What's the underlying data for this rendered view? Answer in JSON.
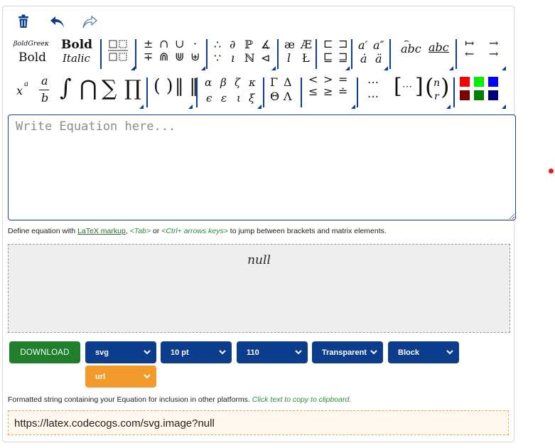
{
  "editor": {
    "placeholder": "Write Equation here...",
    "value": ""
  },
  "toolbar": {
    "icons": [
      "trash-icon",
      "undo-icon",
      "redo-icon"
    ],
    "font_styles": {
      "bold_greek": "βoldGreeκ",
      "bold": "Bold",
      "bold2": "Bold",
      "italic": "Italic"
    },
    "symbols": {
      "pm": "±",
      "mp": "∓",
      "cap": "∩",
      "cup": "∪",
      "Cap": "⋒",
      "Cup": "⋓",
      "cdot": "·",
      "uplus": "⊎",
      "therefore": "∴",
      "because": "∵",
      "partial": "∂",
      "imath": "ı",
      "P": "ℙ",
      "N": "ℕ",
      "angle": "∡",
      "lhd": "⊲",
      "ae": "æ",
      "AE": "Æ",
      "ell": "l",
      "L": "Ł",
      "sqsubset": "⊏",
      "sqsupset": "⊐",
      "sqsubseteq": "⊑",
      "sqsupseteq": "⊒",
      "aprime": "a′",
      "adprime": "a″",
      "adot": "ȧ",
      "addot": "ä",
      "widetilde": "abc",
      "underline": "abc",
      "mapsto": "↦",
      "to": "→",
      "leftarrow": "←",
      "rightarrow": "→",
      "xpow_base": "x",
      "xpow_exp": "a",
      "frac_num": "a",
      "frac_den": "b",
      "integral": "∫",
      "bigcap": "⋂",
      "sum": "∑",
      "prod": "∏",
      "parens": "( )",
      "norms": "‖ ‖",
      "alpha": "α",
      "beta": "β",
      "zeta": "ζ",
      "kappa": "κ",
      "epsilon": "ϵ",
      "varepsilon": "ε",
      "iota": "ι",
      "xi": "ξ",
      "Gamma": "Γ",
      "Delta": "Δ",
      "Theta": "Θ",
      "Lambda": "Λ",
      "lt": "<",
      "gt": ">",
      "eq": "=",
      "le": "≤",
      "ge": "≥",
      "doteq": "≐",
      "cdots": "⋯",
      "cdots2": "⋯",
      "matrix_dots": "⋯",
      "binom_n": "n",
      "binom_r": "r"
    },
    "colors": [
      "#ff0000",
      "#00ee00",
      "#0000ff",
      "#7f0000",
      "#007f00",
      "#00007f"
    ]
  },
  "hint": {
    "prefix": "Define equation with ",
    "link": "LaTeX markup",
    "mid1": ", ",
    "tab": "<Tab>",
    "mid2": " or ",
    "keys": "<Ctrl+ arrows keys>",
    "suffix": " to jump between brackets and matrix elements."
  },
  "preview": {
    "output": "null"
  },
  "controls": {
    "download": "DOWNLOAD",
    "format": "svg",
    "size": "10 pt",
    "dpi": "110",
    "background": "Transparent",
    "display": "Block",
    "output": "url"
  },
  "formatted": {
    "text": "Formatted string containing your Equation for inclusion in other platforms. ",
    "action": "Click text to copy to clipboard."
  },
  "url": {
    "value": "https://latex.codecogs.com/svg.image?null"
  }
}
